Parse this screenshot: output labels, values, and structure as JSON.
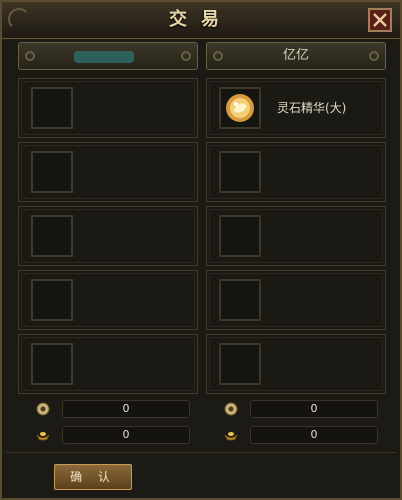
{
  "window": {
    "title": "交易",
    "close_label": "×"
  },
  "left_panel": {
    "player_name": "",
    "slots": [
      {
        "item": ""
      },
      {
        "item": ""
      },
      {
        "item": ""
      },
      {
        "item": ""
      },
      {
        "item": ""
      }
    ],
    "money": {
      "silver": "0",
      "gold": "0"
    }
  },
  "right_panel": {
    "player_name": "亿亿",
    "slots": [
      {
        "item": "灵石精华(大)"
      },
      {
        "item": ""
      },
      {
        "item": ""
      },
      {
        "item": ""
      },
      {
        "item": ""
      }
    ],
    "money": {
      "silver": "0",
      "gold": "0"
    }
  },
  "buttons": {
    "confirm": "确 认"
  },
  "icons": {
    "close": "close-x-icon",
    "silver": "silver-coin-icon",
    "gold": "gold-ingot-icon",
    "item": "spirit-stone-icon"
  },
  "colors": {
    "frame": "#5a4c30",
    "title_text": "#e8d7a8",
    "close_bg": "#5a1f19"
  }
}
